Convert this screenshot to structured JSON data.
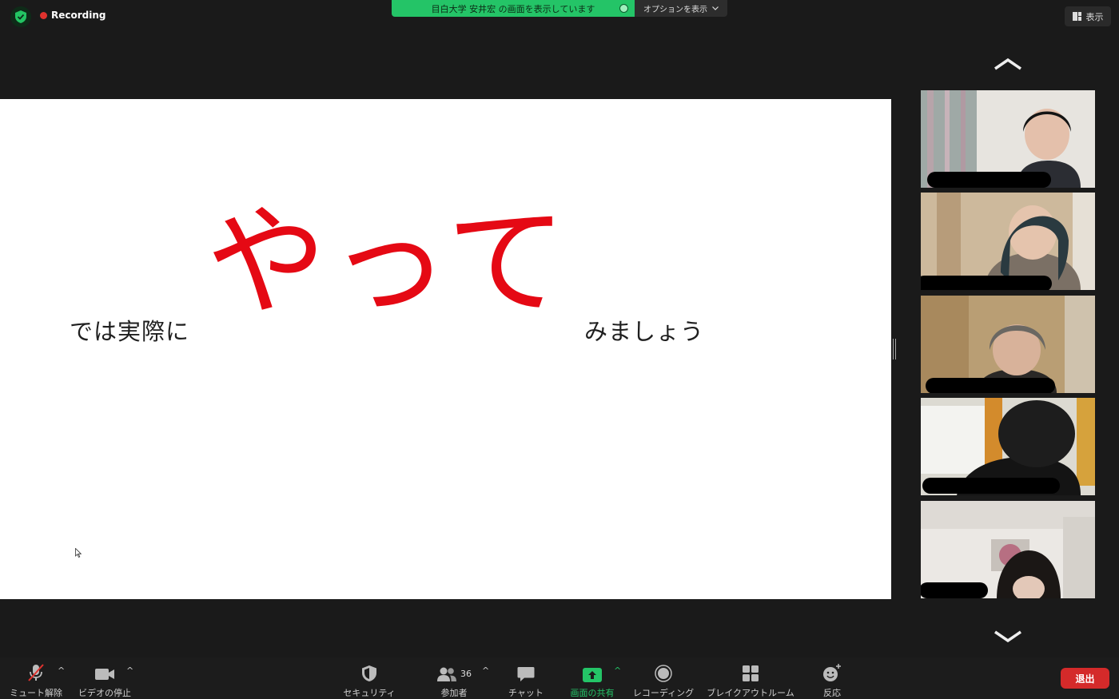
{
  "top_bar": {
    "recording_label": "Recording",
    "share_banner": "目白大学 安井宏 の画面を表示しています",
    "options_label": "オプションを表示",
    "view_label": "表示"
  },
  "slide": {
    "left_text": "では実際に",
    "emphasis_text": "やって",
    "right_text": "みましょう",
    "emphasis_color": "#e50914"
  },
  "toolbar": {
    "mute_label": "ミュート解除",
    "video_label": "ビデオの停止",
    "security_label": "セキュリティ",
    "participants_label": "参加者",
    "participants_count": "36",
    "chat_label": "チャット",
    "share_label": "画面の共有",
    "recording_label": "レコーディング",
    "breakout_label": "ブレイクアウトルーム",
    "reactions_label": "反応",
    "leave_label": "退出"
  },
  "colors": {
    "share_green": "#24c467",
    "leave_red": "#d42a2a",
    "recording_red": "#e0322e"
  }
}
